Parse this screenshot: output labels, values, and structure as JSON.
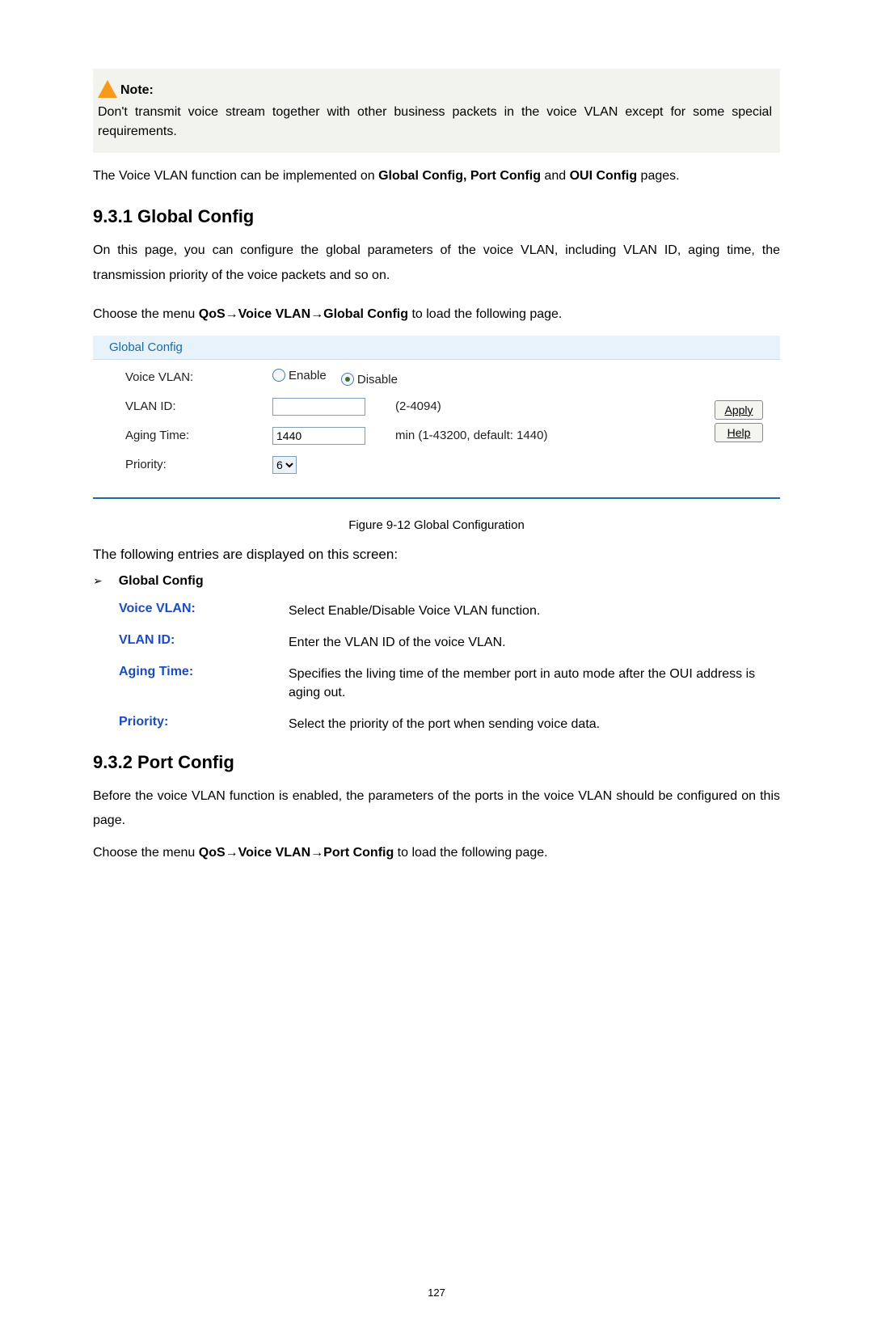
{
  "note": {
    "label": "Note:",
    "body": "Don't transmit voice stream together with other business packets in the voice VLAN except for some special requirements."
  },
  "intro1_a": "The Voice VLAN function can be implemented on ",
  "intro1_b": "Global Config, Port Config",
  "intro1_c": " and ",
  "intro1_d": "OUI Config",
  "intro1_e": " pages.",
  "section1": {
    "heading": "9.3.1 Global Config",
    "p1": "On this page, you can configure the global parameters of the voice VLAN, including VLAN ID, aging time, the transmission priority of the voice packets and so on.",
    "p2_a": "Choose the menu ",
    "p2_b": "QoS→Voice VLAN→Global Config",
    "p2_c": " to load the following page."
  },
  "panel": {
    "title": "Global Config",
    "rows": {
      "voice_vlan": {
        "label": "Voice VLAN:",
        "opt_enable": "Enable",
        "opt_disable": "Disable",
        "selected": "disable"
      },
      "vlan_id": {
        "label": "VLAN ID:",
        "value": "",
        "hint": "(2-4094)"
      },
      "aging_time": {
        "label": "Aging Time:",
        "value": "1440",
        "hint": "min (1-43200, default: 1440)"
      },
      "priority": {
        "label": "Priority:",
        "value": "6"
      }
    },
    "buttons": {
      "apply": "Apply",
      "help": "Help"
    }
  },
  "figure_caption": "Figure 9-12 Global Configuration",
  "entries_intro": "The following entries are displayed on this screen:",
  "bullet_label": "Global Config",
  "defs": [
    {
      "term": "Voice VLAN:",
      "desc": "Select Enable/Disable Voice VLAN function."
    },
    {
      "term": "VLAN ID:",
      "desc": "Enter the VLAN ID of the voice VLAN."
    },
    {
      "term": "Aging Time:",
      "desc": "Specifies the living time of the member port in auto mode after the OUI address is aging out."
    },
    {
      "term": "Priority:",
      "desc": "Select the priority of the port when sending voice data."
    }
  ],
  "section2": {
    "heading": "9.3.2 Port Config",
    "p1": "Before the voice VLAN function is enabled, the parameters of the ports in the voice VLAN should be configured on this page.",
    "p2_a": "Choose the menu ",
    "p2_b": "QoS→Voice VLAN→Port Config",
    "p2_c": " to load the following page."
  },
  "page_number": "127",
  "chart_data": {
    "type": "table",
    "title": "Voice VLAN Global Config form",
    "fields": [
      {
        "name": "Voice VLAN",
        "control": "radio",
        "options": [
          "Enable",
          "Disable"
        ],
        "value": "Disable"
      },
      {
        "name": "VLAN ID",
        "control": "text",
        "value": "",
        "range": "2-4094"
      },
      {
        "name": "Aging Time",
        "control": "text",
        "value": "1440",
        "unit": "min",
        "range": "1-43200",
        "default": 1440
      },
      {
        "name": "Priority",
        "control": "select",
        "value": "6"
      }
    ],
    "actions": [
      "Apply",
      "Help"
    ]
  }
}
